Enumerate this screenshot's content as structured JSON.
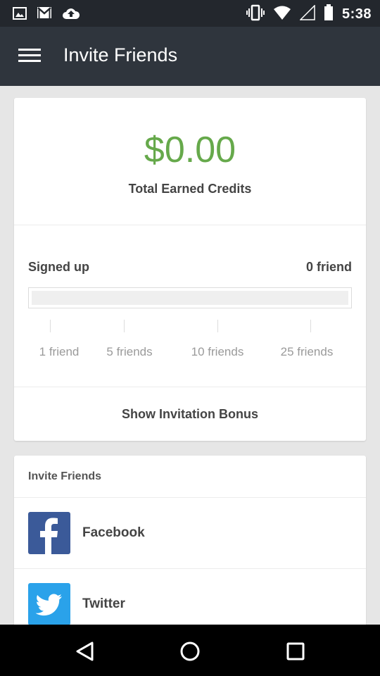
{
  "status_bar": {
    "time": "5:38",
    "left_icons": [
      "image-icon",
      "gmail-icon",
      "cloud-upload-icon"
    ],
    "right_icons": [
      "vibrate-icon",
      "wifi-icon",
      "signal-icon",
      "battery-icon"
    ]
  },
  "app_bar": {
    "title": "Invite Friends",
    "menu_icon": "hamburger-menu-icon"
  },
  "credits": {
    "amount": "$0.00",
    "label": "Total Earned Credits"
  },
  "signup": {
    "label": "Signed up",
    "count": "0 friend",
    "progress": 0,
    "milestones": [
      "1 friend",
      "5 friends",
      "10 friends",
      "25 friends"
    ]
  },
  "bonus": {
    "button_label": "Show Invitation Bonus"
  },
  "invite": {
    "header": "Invite Friends",
    "options": [
      {
        "label": "Facebook",
        "icon": "facebook-icon"
      },
      {
        "label": "Twitter",
        "icon": "twitter-icon"
      }
    ]
  },
  "nav_bar": {
    "icons": [
      "back-icon",
      "home-icon",
      "recents-icon"
    ]
  },
  "colors": {
    "accent_green": "#66a94b",
    "app_bar": "#2f353d",
    "status_bar": "#23272d",
    "facebook": "#3b5a99",
    "twitter": "#2aa2ea"
  }
}
